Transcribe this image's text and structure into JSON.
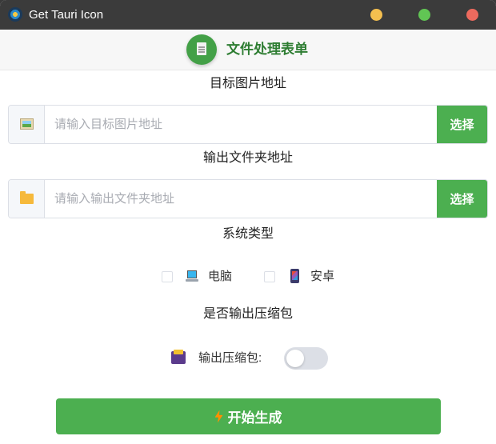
{
  "window": {
    "title": "Get Tauri Icon"
  },
  "header": {
    "title": "文件处理表单",
    "icon": "document-icon"
  },
  "target_image": {
    "label": "目标图片地址",
    "placeholder": "请输入目标图片地址",
    "value": "",
    "button_label": "选择",
    "icon": "image-icon"
  },
  "output_folder": {
    "label": "输出文件夹地址",
    "placeholder": "请输入输出文件夹地址",
    "value": "",
    "button_label": "选择",
    "icon": "folder-icon"
  },
  "system_type": {
    "label": "系统类型",
    "options": [
      {
        "label": "电脑",
        "icon": "laptop-icon",
        "checked": false
      },
      {
        "label": "安卓",
        "icon": "phone-icon",
        "checked": false
      }
    ]
  },
  "zip": {
    "label": "是否输出压缩包",
    "toggle_label": "输出压缩包:",
    "enabled": false,
    "icon": "archive-icon"
  },
  "start": {
    "label": "开始生成",
    "icon": "lightning-icon"
  },
  "colors": {
    "accent": "#4caf50",
    "header_title": "#2e7d32",
    "titlebar": "#3b3b3b"
  }
}
